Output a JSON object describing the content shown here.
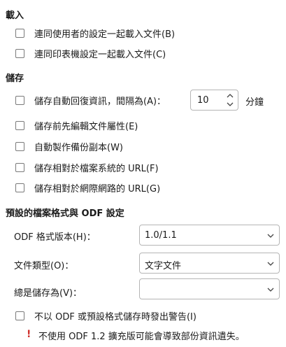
{
  "load": {
    "heading": "載入",
    "options": [
      {
        "label": "連同使用者的設定一起載入文件(B)",
        "checked": false
      },
      {
        "label": "連同印表機設定一起載入文件(C)",
        "checked": false
      }
    ]
  },
  "save": {
    "heading": "儲存",
    "autorecovery": {
      "label": "儲存自動回復資訊，間隔為(A)：",
      "checked": false,
      "value": "10",
      "unit": "分鐘"
    },
    "options": [
      {
        "label": "儲存前先編輯文件屬性(E)",
        "checked": false
      },
      {
        "label": "自動製作備份副本(W)",
        "checked": false
      },
      {
        "label": "儲存相對於檔案系統的 URL(F)",
        "checked": false
      },
      {
        "label": "儲存相對於網際網路的 URL(G)",
        "checked": false
      }
    ]
  },
  "default_format": {
    "heading": "預設的檔案格式與 ODF 設定",
    "odf_version": {
      "label": "ODF 格式版本(H)：",
      "value": "1.0/1.1"
    },
    "doc_type": {
      "label": "文件類型(O)：",
      "value": "文字文件"
    },
    "always_save_as": {
      "label": "總是儲存為(V)：",
      "value": ""
    },
    "warn_option": {
      "label": "不以 ODF 或預設格式儲存時發出警告(I)",
      "checked": false
    },
    "warning": {
      "icon": "exclamation-icon",
      "text": "不使用 ODF 1.2 擴充版可能會導致部份資訊遺失。",
      "color": "#d0302c"
    }
  }
}
